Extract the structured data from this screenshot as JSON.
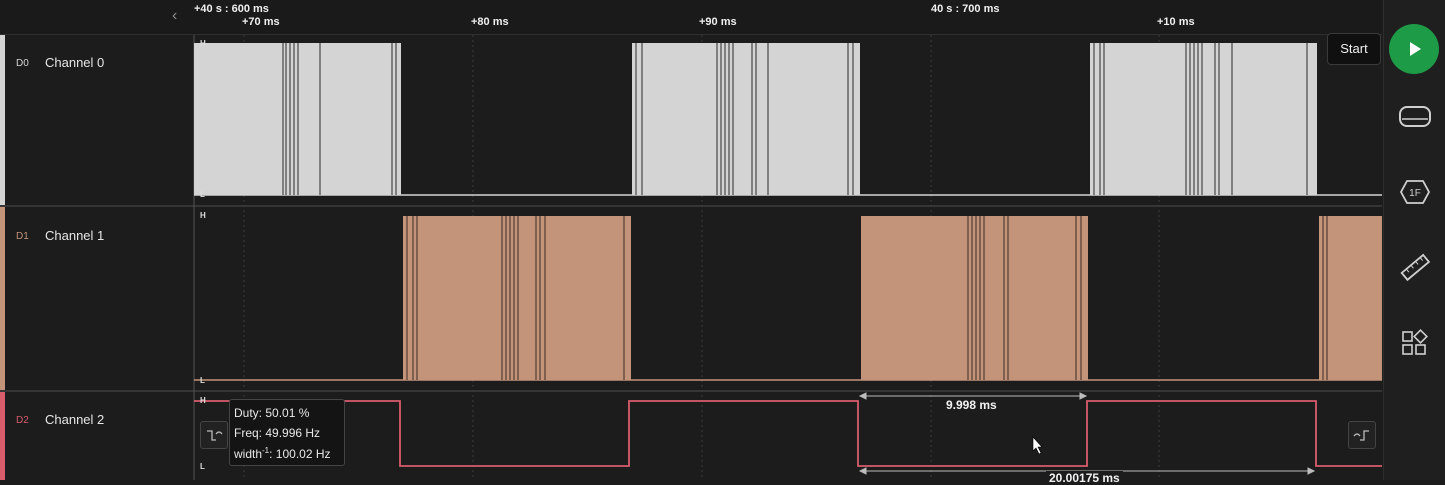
{
  "timeline": {
    "major_left": "+40 s : 600 ms",
    "major_mid": "40 s : 700 ms",
    "ticks": [
      "+70 ms",
      "+80 ms",
      "+90 ms",
      "+10 ms"
    ]
  },
  "channels": [
    {
      "code": "D0",
      "name": "Channel 0",
      "color": "#d4d4d4"
    },
    {
      "code": "D1",
      "name": "Channel 1",
      "color": "#c4947a"
    },
    {
      "code": "D2",
      "name": "Channel 2",
      "color": "#d85c6c"
    }
  ],
  "levels": {
    "high": "H",
    "low": "L"
  },
  "tooltip": {
    "duty": "Duty: 50.01 %",
    "freq": "Freq: 49.996 Hz",
    "width_prefix": "width",
    "width_sup": "-1",
    "width_value": ": 100.02 Hz"
  },
  "measurements": {
    "pulse_width": "9.998 ms",
    "period": "20.00175 ms"
  },
  "toolbar": {
    "start_label": "Start",
    "icons": [
      "play-icon",
      "device-icon",
      "analyzer-1f-icon",
      "ruler-icon",
      "extensions-icon"
    ]
  },
  "colors": {
    "accent_green": "#1e9b47",
    "d0": "#d4d4d4",
    "d1": "#c4947a",
    "d2": "#d85c6c"
  }
}
